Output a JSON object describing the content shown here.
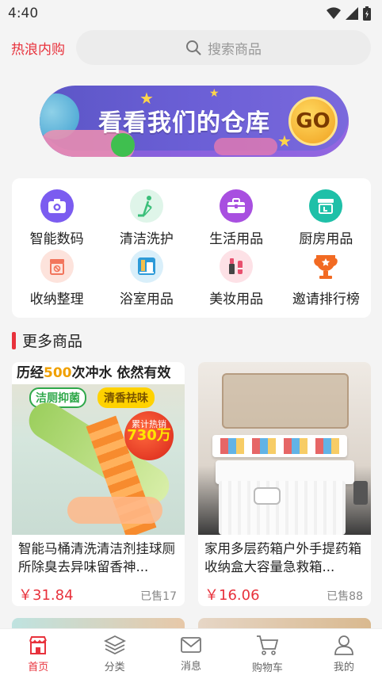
{
  "status_bar": {
    "time": "4:40"
  },
  "header": {
    "brand": "热浪内购",
    "search_placeholder": "搜索商品"
  },
  "banner": {
    "title": "看看我们的仓库",
    "go_label": "GO"
  },
  "categories": [
    {
      "label": "智能数码",
      "icon": "camera-icon",
      "color": "#7b5cf0"
    },
    {
      "label": "清洁洗护",
      "icon": "mop-icon",
      "color": "#3bbf7a"
    },
    {
      "label": "生活用品",
      "icon": "briefcase-icon",
      "color": "#a84fe0"
    },
    {
      "label": "厨房用品",
      "icon": "sink-icon",
      "color": "#1fc0a8"
    },
    {
      "label": "收纳整理",
      "icon": "storage-box-icon",
      "color": "#f2755c"
    },
    {
      "label": "浴室用品",
      "icon": "shower-icon",
      "color": "#2d9ad8"
    },
    {
      "label": "美妆用品",
      "icon": "makeup-icon",
      "color": "#e8506e"
    },
    {
      "label": "邀请排行榜",
      "icon": "trophy-icon",
      "color": "#f26a22"
    }
  ],
  "section": {
    "title": "更多商品"
  },
  "products": [
    {
      "name": "智能马桶清洗清洁剂挂球厕所除臭去异味留香神...",
      "price": "￥31.84",
      "sold": "已售17",
      "art": {
        "headline_a": "历经",
        "headline_num": "500",
        "headline_b": "次冲水 依然有效",
        "tag1": "洁厕抑菌",
        "tag2": "清香祛味",
        "badge_top": "累计热销",
        "badge_num": "730万"
      }
    },
    {
      "name": "家用多层药箱户外手提药箱收纳盒大容量急救箱...",
      "price": "￥16.06",
      "sold": "已售88"
    }
  ],
  "tabs": [
    {
      "label": "首页",
      "icon": "home-icon",
      "active": true
    },
    {
      "label": "分类",
      "icon": "layers-icon",
      "active": false
    },
    {
      "label": "消息",
      "icon": "mail-icon",
      "active": false
    },
    {
      "label": "购物车",
      "icon": "cart-icon",
      "active": false
    },
    {
      "label": "我的",
      "icon": "user-icon",
      "active": false
    }
  ],
  "colors": {
    "accent": "#e8323c"
  }
}
